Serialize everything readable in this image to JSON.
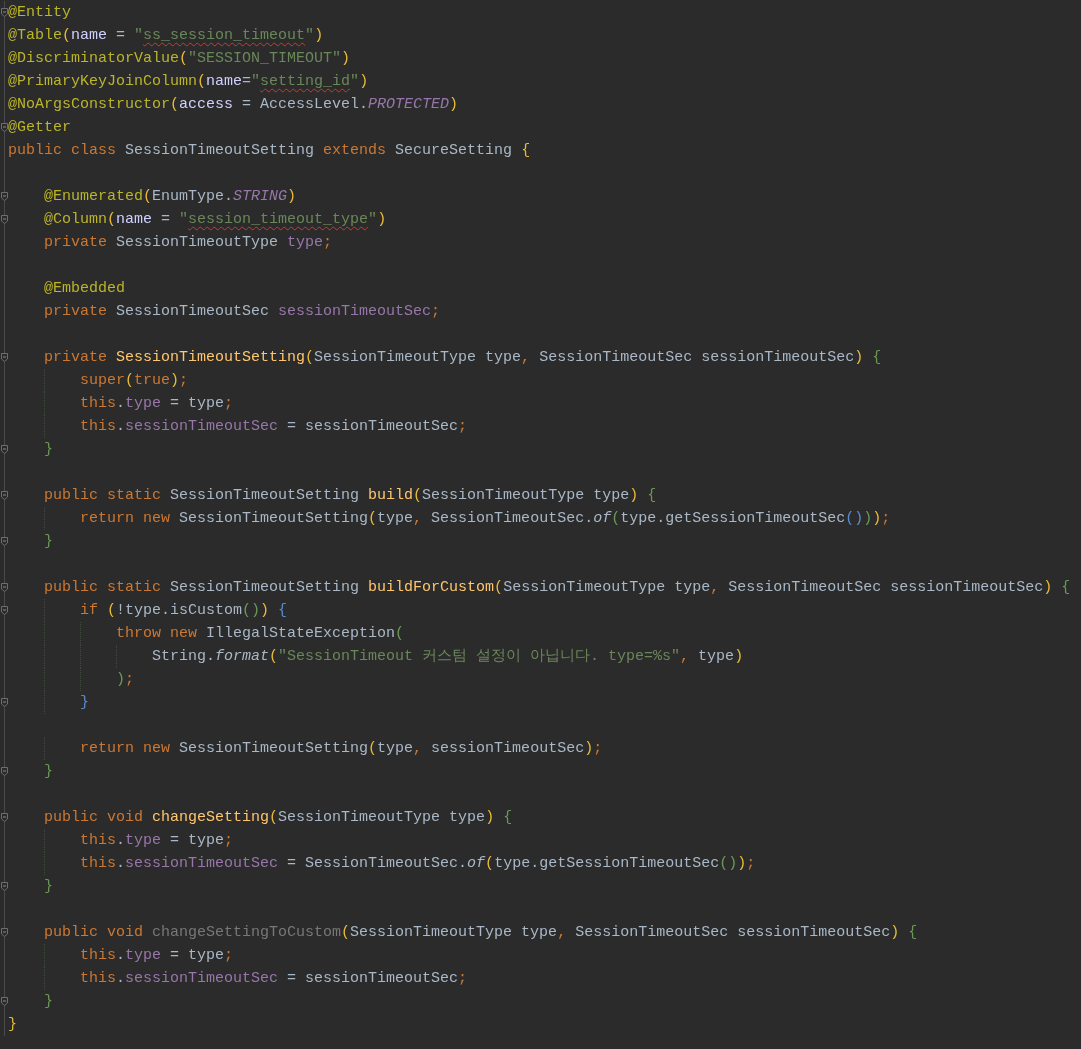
{
  "editor": {
    "lines": [
      {
        "kind": "code",
        "fold": true,
        "tokens": [
          {
            "text": "@Entity",
            "kind": "ann"
          }
        ]
      },
      {
        "kind": "code",
        "fold": false,
        "tokens": [
          {
            "text": "@Table",
            "kind": "ann"
          },
          {
            "text": "(",
            "kind": "by"
          },
          {
            "text": "name",
            "kind": "attr"
          },
          {
            "text": " = ",
            "kind": "plain"
          },
          {
            "text": "\"",
            "kind": "str"
          },
          {
            "text": "ss_session_timeout",
            "kind": "str",
            "typo": true
          },
          {
            "text": "\"",
            "kind": "str"
          },
          {
            "text": ")",
            "kind": "by"
          }
        ]
      },
      {
        "kind": "code",
        "fold": false,
        "tokens": [
          {
            "text": "@DiscriminatorValue",
            "kind": "ann"
          },
          {
            "text": "(",
            "kind": "by"
          },
          {
            "text": "\"SESSION_TIMEOUT\"",
            "kind": "str"
          },
          {
            "text": ")",
            "kind": "by"
          }
        ]
      },
      {
        "kind": "code",
        "fold": false,
        "tokens": [
          {
            "text": "@PrimaryKeyJoinColumn",
            "kind": "ann"
          },
          {
            "text": "(",
            "kind": "by"
          },
          {
            "text": "name",
            "kind": "attr"
          },
          {
            "text": "=",
            "kind": "plain"
          },
          {
            "text": "\"",
            "kind": "str"
          },
          {
            "text": "setting_id",
            "kind": "str",
            "typo": true
          },
          {
            "text": "\"",
            "kind": "str"
          },
          {
            "text": ")",
            "kind": "by"
          }
        ]
      },
      {
        "kind": "code",
        "fold": false,
        "tokens": [
          {
            "text": "@NoArgsConstructor",
            "kind": "ann"
          },
          {
            "text": "(",
            "kind": "by"
          },
          {
            "text": "access",
            "kind": "attr"
          },
          {
            "text": " = AccessLevel.",
            "kind": "plain"
          },
          {
            "text": "PROTECTED",
            "kind": "const"
          },
          {
            "text": ")",
            "kind": "by"
          }
        ]
      },
      {
        "kind": "code",
        "fold": true,
        "tokens": [
          {
            "text": "@Getter",
            "kind": "ann"
          }
        ]
      },
      {
        "kind": "code",
        "fold": false,
        "tokens": [
          {
            "text": "public class ",
            "kind": "kw"
          },
          {
            "text": "SessionTimeoutSetting ",
            "kind": "plain"
          },
          {
            "text": "extends ",
            "kind": "kw"
          },
          {
            "text": "SecureSetting ",
            "kind": "plain"
          },
          {
            "text": "{",
            "kind": "by"
          }
        ],
        "children": [
          {
            "kind": "blank"
          },
          {
            "kind": "code",
            "fold": true,
            "tokens": [
              {
                "text": "@Enumerated",
                "kind": "ann"
              },
              {
                "text": "(",
                "kind": "by"
              },
              {
                "text": "EnumType.",
                "kind": "plain"
              },
              {
                "text": "STRING",
                "kind": "const"
              },
              {
                "text": ")",
                "kind": "by"
              }
            ]
          },
          {
            "kind": "code",
            "fold": true,
            "tokens": [
              {
                "text": "@Column",
                "kind": "ann"
              },
              {
                "text": "(",
                "kind": "by"
              },
              {
                "text": "name",
                "kind": "attr"
              },
              {
                "text": " = ",
                "kind": "plain"
              },
              {
                "text": "\"",
                "kind": "str"
              },
              {
                "text": "session_timeout_type",
                "kind": "str",
                "typo": true
              },
              {
                "text": "\"",
                "kind": "str"
              },
              {
                "text": ")",
                "kind": "by"
              }
            ]
          },
          {
            "kind": "code",
            "fold": false,
            "tokens": [
              {
                "text": "private ",
                "kind": "kw"
              },
              {
                "text": "SessionTimeoutType ",
                "kind": "plain"
              },
              {
                "text": "type",
                "kind": "field"
              },
              {
                "text": ";",
                "kind": "punct"
              }
            ]
          },
          {
            "kind": "blank"
          },
          {
            "kind": "code",
            "fold": false,
            "tokens": [
              {
                "text": "@Embedded",
                "kind": "ann"
              }
            ]
          },
          {
            "kind": "code",
            "fold": false,
            "tokens": [
              {
                "text": "private ",
                "kind": "kw"
              },
              {
                "text": "SessionTimeoutSec ",
                "kind": "plain"
              },
              {
                "text": "sessionTimeoutSec",
                "kind": "field"
              },
              {
                "text": ";",
                "kind": "punct"
              }
            ]
          },
          {
            "kind": "blank"
          },
          {
            "kind": "code",
            "fold": true,
            "tokens": [
              {
                "text": "private ",
                "kind": "kw"
              },
              {
                "text": "SessionTimeoutSetting",
                "kind": "method"
              },
              {
                "text": "(",
                "kind": "by"
              },
              {
                "text": "SessionTimeoutType type",
                "kind": "plain"
              },
              {
                "text": ", ",
                "kind": "punct"
              },
              {
                "text": "SessionTimeoutSec sessionTimeoutSec",
                "kind": "plain"
              },
              {
                "text": ") ",
                "kind": "by"
              },
              {
                "text": "{",
                "kind": "bg"
              }
            ],
            "children": [
              {
                "kind": "code",
                "fold": false,
                "tokens": [
                  {
                    "text": "super",
                    "kind": "kw"
                  },
                  {
                    "text": "(",
                    "kind": "by"
                  },
                  {
                    "text": "true",
                    "kind": "kw"
                  },
                  {
                    "text": ")",
                    "kind": "by"
                  },
                  {
                    "text": ";",
                    "kind": "punct"
                  }
                ]
              },
              {
                "kind": "code",
                "fold": false,
                "tokens": [
                  {
                    "text": "this",
                    "kind": "kw"
                  },
                  {
                    "text": ".",
                    "kind": "plain"
                  },
                  {
                    "text": "type",
                    "kind": "field"
                  },
                  {
                    "text": " = type",
                    "kind": "plain"
                  },
                  {
                    "text": ";",
                    "kind": "punct"
                  }
                ]
              },
              {
                "kind": "code",
                "fold": false,
                "tokens": [
                  {
                    "text": "this",
                    "kind": "kw"
                  },
                  {
                    "text": ".",
                    "kind": "plain"
                  },
                  {
                    "text": "sessionTimeoutSec",
                    "kind": "field"
                  },
                  {
                    "text": " = sessionTimeoutSec",
                    "kind": "plain"
                  },
                  {
                    "text": ";",
                    "kind": "punct"
                  }
                ]
              }
            ]
          },
          {
            "kind": "code",
            "fold": true,
            "tokens": [
              {
                "text": "}",
                "kind": "bg"
              }
            ]
          },
          {
            "kind": "blank"
          },
          {
            "kind": "code",
            "fold": true,
            "tokens": [
              {
                "text": "public static ",
                "kind": "kw"
              },
              {
                "text": "SessionTimeoutSetting ",
                "kind": "plain"
              },
              {
                "text": "build",
                "kind": "method"
              },
              {
                "text": "(",
                "kind": "by"
              },
              {
                "text": "SessionTimeoutType type",
                "kind": "plain"
              },
              {
                "text": ") ",
                "kind": "by"
              },
              {
                "text": "{",
                "kind": "bg"
              }
            ],
            "children": [
              {
                "kind": "code",
                "fold": false,
                "tokens": [
                  {
                    "text": "return new ",
                    "kind": "kw"
                  },
                  {
                    "text": "SessionTimeoutSetting",
                    "kind": "plain"
                  },
                  {
                    "text": "(",
                    "kind": "by"
                  },
                  {
                    "text": "type",
                    "kind": "plain"
                  },
                  {
                    "text": ", ",
                    "kind": "punct"
                  },
                  {
                    "text": "SessionTimeoutSec.",
                    "kind": "plain"
                  },
                  {
                    "text": "of",
                    "kind": "static"
                  },
                  {
                    "text": "(",
                    "kind": "bg"
                  },
                  {
                    "text": "type.getSessionTimeoutSec",
                    "kind": "plain"
                  },
                  {
                    "text": "()",
                    "kind": "bb"
                  },
                  {
                    "text": ")",
                    "kind": "bg"
                  },
                  {
                    "text": ")",
                    "kind": "by"
                  },
                  {
                    "text": ";",
                    "kind": "punct"
                  }
                ]
              }
            ]
          },
          {
            "kind": "code",
            "fold": true,
            "tokens": [
              {
                "text": "}",
                "kind": "bg"
              }
            ]
          },
          {
            "kind": "blank"
          },
          {
            "kind": "code",
            "fold": true,
            "tokens": [
              {
                "text": "public static ",
                "kind": "kw"
              },
              {
                "text": "SessionTimeoutSetting ",
                "kind": "plain"
              },
              {
                "text": "buildForCustom",
                "kind": "method"
              },
              {
                "text": "(",
                "kind": "by"
              },
              {
                "text": "SessionTimeoutType type",
                "kind": "plain"
              },
              {
                "text": ", ",
                "kind": "punct"
              },
              {
                "text": "SessionTimeoutSec sessionTimeoutSec",
                "kind": "plain"
              },
              {
                "text": ") ",
                "kind": "by"
              },
              {
                "text": "{",
                "kind": "bg"
              }
            ],
            "children": [
              {
                "kind": "code",
                "fold": true,
                "tokens": [
                  {
                    "text": "if ",
                    "kind": "kw"
                  },
                  {
                    "text": "(",
                    "kind": "by"
                  },
                  {
                    "text": "!type.isCustom",
                    "kind": "plain"
                  },
                  {
                    "text": "()",
                    "kind": "bg"
                  },
                  {
                    "text": ") ",
                    "kind": "by"
                  },
                  {
                    "text": "{",
                    "kind": "bb"
                  }
                ],
                "children": [
                  {
                    "kind": "code",
                    "fold": false,
                    "tokens": [
                      {
                        "text": "throw new ",
                        "kind": "kw"
                      },
                      {
                        "text": "IllegalStateException",
                        "kind": "plain"
                      },
                      {
                        "text": "(",
                        "kind": "bg"
                      }
                    ],
                    "children": [
                      {
                        "kind": "code",
                        "fold": false,
                        "tokens": [
                          {
                            "text": "String.",
                            "kind": "plain"
                          },
                          {
                            "text": "format",
                            "kind": "static"
                          },
                          {
                            "text": "(",
                            "kind": "by"
                          },
                          {
                            "text": "\"SessionTimeout 커스텀 설정이 아닙니다. type=%s\"",
                            "kind": "str"
                          },
                          {
                            "text": ", ",
                            "kind": "punct"
                          },
                          {
                            "text": "type",
                            "kind": "plain"
                          },
                          {
                            "text": ")",
                            "kind": "by"
                          }
                        ]
                      }
                    ]
                  },
                  {
                    "kind": "code",
                    "fold": false,
                    "tokens": [
                      {
                        "text": ")",
                        "kind": "bg"
                      },
                      {
                        "text": ";",
                        "kind": "punct"
                      }
                    ]
                  }
                ]
              },
              {
                "kind": "code",
                "fold": true,
                "tokens": [
                  {
                    "text": "}",
                    "kind": "bb"
                  }
                ]
              },
              {
                "kind": "blank"
              },
              {
                "kind": "code",
                "fold": false,
                "tokens": [
                  {
                    "text": "return new ",
                    "kind": "kw"
                  },
                  {
                    "text": "SessionTimeoutSetting",
                    "kind": "plain"
                  },
                  {
                    "text": "(",
                    "kind": "by"
                  },
                  {
                    "text": "type",
                    "kind": "plain"
                  },
                  {
                    "text": ", ",
                    "kind": "punct"
                  },
                  {
                    "text": "sessionTimeoutSec",
                    "kind": "plain"
                  },
                  {
                    "text": ")",
                    "kind": "by"
                  },
                  {
                    "text": ";",
                    "kind": "punct"
                  }
                ]
              }
            ]
          },
          {
            "kind": "code",
            "fold": true,
            "tokens": [
              {
                "text": "}",
                "kind": "bg"
              }
            ]
          },
          {
            "kind": "blank"
          },
          {
            "kind": "code",
            "fold": true,
            "tokens": [
              {
                "text": "public void ",
                "kind": "kw"
              },
              {
                "text": "changeSetting",
                "kind": "method"
              },
              {
                "text": "(",
                "kind": "by"
              },
              {
                "text": "SessionTimeoutType type",
                "kind": "plain"
              },
              {
                "text": ") ",
                "kind": "by"
              },
              {
                "text": "{",
                "kind": "bg"
              }
            ],
            "children": [
              {
                "kind": "code",
                "fold": false,
                "tokens": [
                  {
                    "text": "this",
                    "kind": "kw"
                  },
                  {
                    "text": ".",
                    "kind": "plain"
                  },
                  {
                    "text": "type",
                    "kind": "field"
                  },
                  {
                    "text": " = type",
                    "kind": "plain"
                  },
                  {
                    "text": ";",
                    "kind": "punct"
                  }
                ]
              },
              {
                "kind": "code",
                "fold": false,
                "tokens": [
                  {
                    "text": "this",
                    "kind": "kw"
                  },
                  {
                    "text": ".",
                    "kind": "plain"
                  },
                  {
                    "text": "sessionTimeoutSec",
                    "kind": "field"
                  },
                  {
                    "text": " = SessionTimeoutSec.",
                    "kind": "plain"
                  },
                  {
                    "text": "of",
                    "kind": "static"
                  },
                  {
                    "text": "(",
                    "kind": "by"
                  },
                  {
                    "text": "type.getSessionTimeoutSec",
                    "kind": "plain"
                  },
                  {
                    "text": "()",
                    "kind": "bg"
                  },
                  {
                    "text": ")",
                    "kind": "by"
                  },
                  {
                    "text": ";",
                    "kind": "punct"
                  }
                ]
              }
            ]
          },
          {
            "kind": "code",
            "fold": true,
            "tokens": [
              {
                "text": "}",
                "kind": "bg"
              }
            ]
          },
          {
            "kind": "blank"
          },
          {
            "kind": "code",
            "fold": true,
            "tokens": [
              {
                "text": "public void ",
                "kind": "kw"
              },
              {
                "text": "changeSettingToCustom",
                "kind": "unused"
              },
              {
                "text": "(",
                "kind": "by"
              },
              {
                "text": "SessionTimeoutType type",
                "kind": "plain"
              },
              {
                "text": ", ",
                "kind": "punct"
              },
              {
                "text": "SessionTimeoutSec sessionTimeoutSec",
                "kind": "plain"
              },
              {
                "text": ") ",
                "kind": "by"
              },
              {
                "text": "{",
                "kind": "bg"
              }
            ],
            "children": [
              {
                "kind": "code",
                "fold": false,
                "tokens": [
                  {
                    "text": "this",
                    "kind": "kw"
                  },
                  {
                    "text": ".",
                    "kind": "plain"
                  },
                  {
                    "text": "type",
                    "kind": "field"
                  },
                  {
                    "text": " = type",
                    "kind": "plain"
                  },
                  {
                    "text": ";",
                    "kind": "punct"
                  }
                ]
              },
              {
                "kind": "code",
                "fold": false,
                "tokens": [
                  {
                    "text": "this",
                    "kind": "kw"
                  },
                  {
                    "text": ".",
                    "kind": "plain"
                  },
                  {
                    "text": "sessionTimeoutSec",
                    "kind": "field"
                  },
                  {
                    "text": " = sessionTimeoutSec",
                    "kind": "plain"
                  },
                  {
                    "text": ";",
                    "kind": "punct"
                  }
                ]
              }
            ]
          },
          {
            "kind": "code",
            "fold": true,
            "tokens": [
              {
                "text": "}",
                "kind": "bg"
              }
            ]
          }
        ]
      },
      {
        "kind": "code",
        "fold": false,
        "tokens": [
          {
            "text": "}",
            "kind": "by"
          }
        ]
      }
    ]
  }
}
